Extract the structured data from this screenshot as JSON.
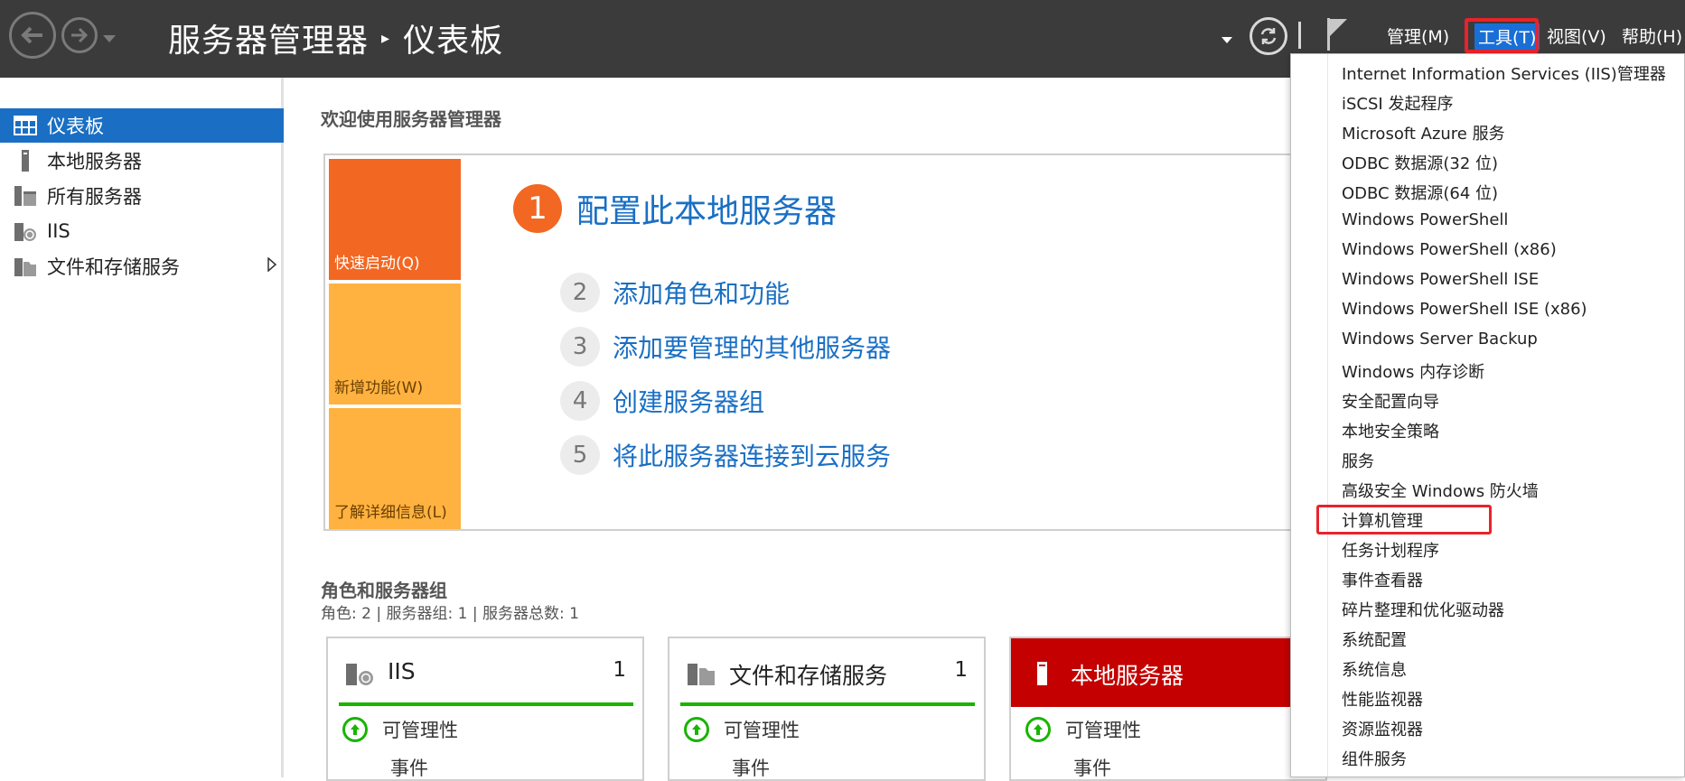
{
  "titlebar": {
    "app": "服务器管理器",
    "separator": "▸",
    "page": "仪表板",
    "menus": [
      "管理(M)",
      "工具(T)",
      "视图(V)",
      "帮助(H)"
    ]
  },
  "sidebar": {
    "items": [
      {
        "label": "仪表板",
        "icon": "dashboard-icon"
      },
      {
        "label": "本地服务器",
        "icon": "server-icon"
      },
      {
        "label": "所有服务器",
        "icon": "servers-icon"
      },
      {
        "label": "IIS",
        "icon": "iis-icon"
      },
      {
        "label": "文件和存储服务",
        "icon": "storage-icon"
      }
    ]
  },
  "main": {
    "welcome": "欢迎使用服务器管理器",
    "tiles": [
      "快速启动(Q)",
      "新增功能(W)",
      "了解详细信息(L)"
    ],
    "steps": [
      {
        "num": "1",
        "label": "配置此本地服务器"
      },
      {
        "num": "2",
        "label": "添加角色和功能"
      },
      {
        "num": "3",
        "label": "添加要管理的其他服务器"
      },
      {
        "num": "4",
        "label": "创建服务器组"
      },
      {
        "num": "5",
        "label": "将此服务器连接到云服务"
      }
    ],
    "roles_title": "角色和服务器组",
    "roles_sub": "角色: 2 | 服务器组: 1 | 服务器总数: 1",
    "cards": [
      {
        "title": "IIS",
        "count": "1",
        "row1": "可管理性",
        "row2": "事件"
      },
      {
        "title": "文件和存储服务",
        "count": "1",
        "row1": "可管理性",
        "row2": "事件"
      },
      {
        "title": "本地服务器",
        "count": "",
        "row1": "可管理性",
        "row2": "事件"
      }
    ]
  },
  "tools_menu": {
    "items": [
      "Internet Information Services (IIS)管理器",
      "iSCSI 发起程序",
      "Microsoft Azure 服务",
      "ODBC 数据源(32 位)",
      "ODBC 数据源(64 位)",
      "Windows PowerShell",
      "Windows PowerShell (x86)",
      "Windows PowerShell ISE",
      "Windows PowerShell ISE (x86)",
      "Windows Server Backup",
      "Windows 内存诊断",
      "安全配置向导",
      "本地安全策略",
      "服务",
      "高级安全 Windows 防火墙",
      "计算机管理",
      "任务计划程序",
      "事件查看器",
      "碎片整理和优化驱动器",
      "系统配置",
      "系统信息",
      "性能监视器",
      "资源监视器",
      "组件服务"
    ],
    "highlighted": "计算机管理"
  },
  "colors": {
    "titlebar": "#3b3b3b",
    "accent_blue": "#1a6fc4",
    "orange": "#f26722",
    "light_orange": "#ffb240",
    "green": "#19b400",
    "red": "#c40000",
    "highlight_box": "#e8232b"
  }
}
